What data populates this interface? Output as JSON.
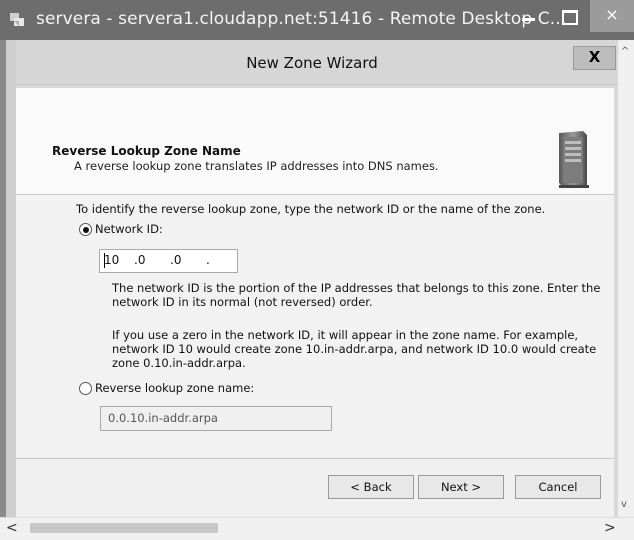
{
  "rdp": {
    "title": "servera - servera1.cloudapp.net:51416 - Remote Desktop C...",
    "minimize_glyph": "–",
    "maximize_glyph": "□",
    "close_glyph": "×"
  },
  "wizard": {
    "title": "New Zone Wizard",
    "close_glyph": "X",
    "header": {
      "title": "Reverse Lookup Zone Name",
      "subtitle": "A reverse lookup zone translates IP addresses into DNS names.",
      "icon": "server-icon"
    },
    "instruction": "To identify the reverse lookup zone, type the network ID or the name of the zone.",
    "network_id": {
      "label": "Network ID:",
      "selected": true,
      "octets": [
        "10",
        ".0",
        ".0",
        "."
      ],
      "description_1": [
        "The network ID is the portion of the IP addresses that belongs to this zone. Enter the",
        "network ID in its normal (not reversed) order."
      ],
      "description_2": [
        "If you use a zero in the network ID, it will appear in the zone name. For example,",
        "network ID 10 would create zone 10.in-addr.arpa, and network ID 10.0 would create",
        "zone 0.10.in-addr.arpa."
      ]
    },
    "zone_name": {
      "label": "Reverse lookup zone name:",
      "selected": false,
      "value": "0.0.10.in-addr.arpa"
    },
    "buttons": {
      "back": "< Back",
      "next": "Next >",
      "cancel": "Cancel"
    }
  },
  "scrollbars": {
    "up_glyph": "^",
    "down_glyph": "v",
    "left_glyph": "<",
    "right_glyph": ">"
  }
}
